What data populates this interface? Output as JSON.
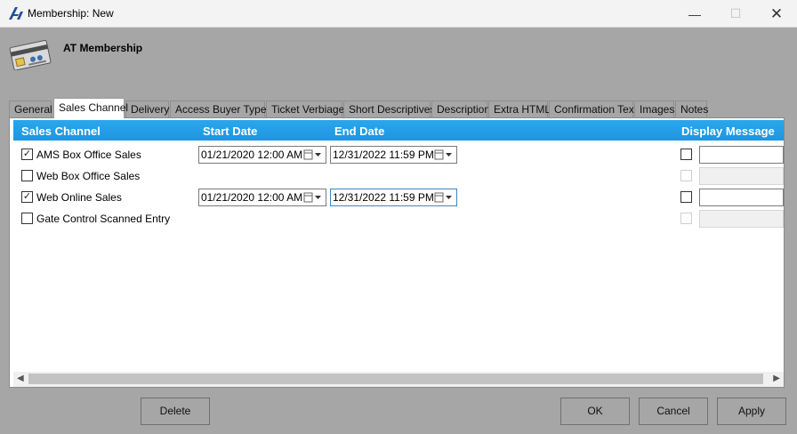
{
  "window": {
    "title": "Membership: New",
    "minimize_glyph": "—",
    "maximize_glyph": "☐",
    "close_glyph": "✕",
    "accent": "#1e4f9c"
  },
  "header": {
    "title": "AT Membership",
    "icon": "membership-card-icon"
  },
  "tabs": [
    "General",
    "Sales Channel",
    "Delivery",
    "Access Buyer Types",
    "Ticket Verbiage",
    "Short Descriptives",
    "Description",
    "Extra HTML",
    "Confirmation Text",
    "Images",
    "Notes"
  ],
  "active_tab": "Sales Channel",
  "grid": {
    "columns": {
      "channel": "Sales Channel",
      "start": "Start Date",
      "end": "End Date",
      "display": "Display Message"
    },
    "header_color": "#1e95e0",
    "rows": [
      {
        "label": "AMS Box Office Sales",
        "checked": true,
        "check_glyph": "✓",
        "start": "01/21/2020 12:00 AM",
        "end": "12/31/2022 11:59 PM"
      },
      {
        "label": "Web Box Office Sales",
        "checked": false,
        "check_glyph": ""
      },
      {
        "label": "Web Online Sales",
        "checked": true,
        "check_glyph": "✓",
        "start": "01/21/2020 12:00 AM",
        "end": "12/31/2022 11:59 PM"
      },
      {
        "label": "Gate Control Scanned Entry",
        "checked": false,
        "check_glyph": ""
      }
    ]
  },
  "scrollbar": {
    "left_arrow": "◀",
    "right_arrow": "▶"
  },
  "buttons": {
    "delete": "Delete",
    "ok": "OK",
    "cancel": "Cancel",
    "apply": "Apply"
  }
}
